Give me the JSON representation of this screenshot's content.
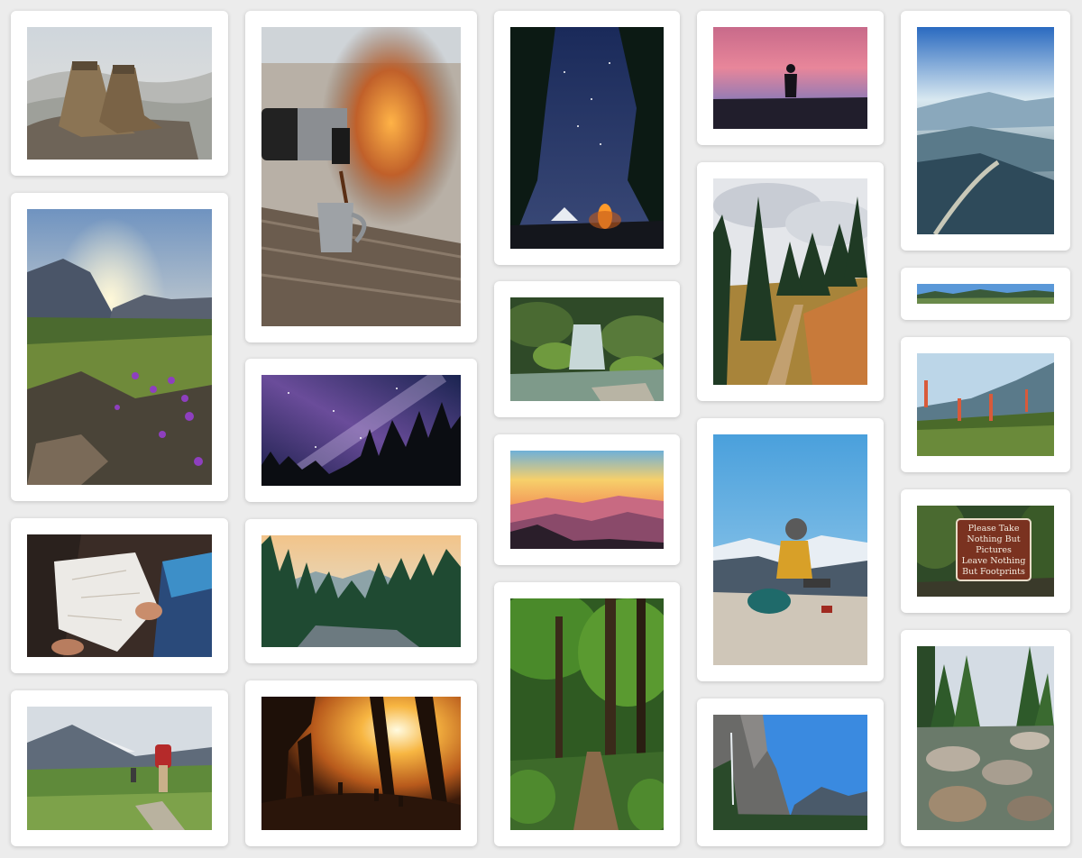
{
  "gallery": {
    "photos": [
      {
        "subject": "hiking boots on rock"
      },
      {
        "subject": "alpine sunrise with purple wildflowers"
      },
      {
        "subject": "hands reading paper map"
      },
      {
        "subject": "hiker with red backpack on mountain trail"
      },
      {
        "subject": "coffee poured from thermos at campfire"
      },
      {
        "subject": "milky way over pine forest"
      },
      {
        "subject": "sunset over mountain pine forest"
      },
      {
        "subject": "hikers silhouetted in sunlit forest"
      },
      {
        "subject": "tent and campfire under starry sky"
      },
      {
        "subject": "mossy forest waterfall"
      },
      {
        "subject": "layered mountains at sunset"
      },
      {
        "subject": "forest trail between tall trees"
      },
      {
        "subject": "hiker silhouette at dusk"
      },
      {
        "subject": "trail through pine forest meadow"
      },
      {
        "subject": "woman with backpack sitting on rock"
      },
      {
        "subject": "granite cliffs and waterfall"
      },
      {
        "subject": "misty mountain valley with river"
      },
      {
        "subject": "wide mountain panorama"
      },
      {
        "subject": "wildflowers with mountain view"
      },
      {
        "subject": "trail sign"
      },
      {
        "subject": "rocky creek in forest"
      }
    ],
    "sign_text": [
      "Please Take",
      "Nothing But",
      "Pictures",
      "Leave Nothing",
      "But Footprints"
    ]
  }
}
